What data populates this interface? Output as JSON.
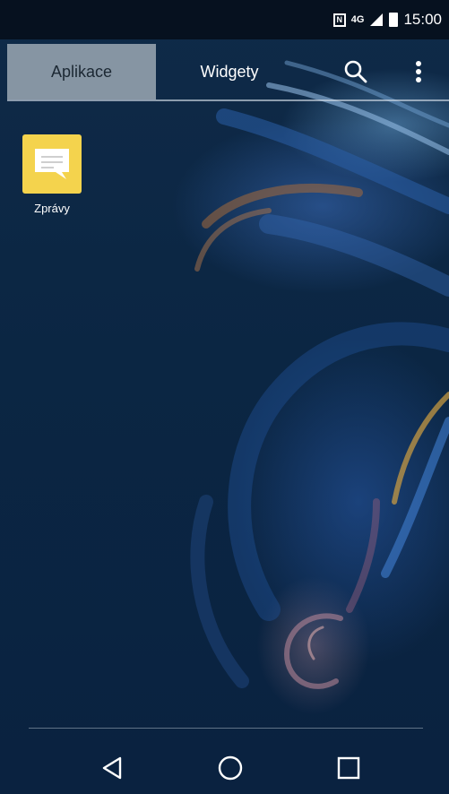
{
  "status_bar": {
    "nfc_label": "N",
    "network_label": "4G",
    "time": "15:00"
  },
  "tabs": [
    {
      "label": "Aplikace",
      "active": true
    },
    {
      "label": "Widgety",
      "active": false
    }
  ],
  "actions": {
    "search_icon": "search-icon",
    "overflow_icon": "more-vert-icon"
  },
  "apps": [
    {
      "label": "Zprávy",
      "icon": "messages-icon",
      "color": "#f4d34d"
    }
  ],
  "nav": {
    "back_icon": "back-icon",
    "home_icon": "home-icon",
    "recents_icon": "recents-icon"
  }
}
